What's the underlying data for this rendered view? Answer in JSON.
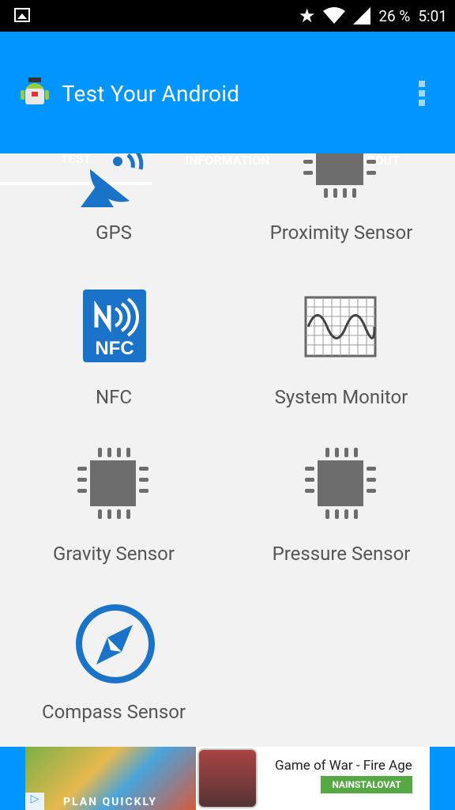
{
  "status": {
    "battery": "26 %",
    "time": "5:01"
  },
  "app": {
    "title": "Test Your Android"
  },
  "tabs": [
    "TEST",
    "INFORMATION",
    "ABOUT"
  ],
  "items": [
    {
      "label": "GPS",
      "icon": "satellite-dish-icon"
    },
    {
      "label": "Proximity Sensor",
      "icon": "chip-icon"
    },
    {
      "label": "NFC",
      "icon": "nfc-icon"
    },
    {
      "label": "System Monitor",
      "icon": "oscilloscope-icon"
    },
    {
      "label": "Gravity Sensor",
      "icon": "chip-icon"
    },
    {
      "label": "Pressure Sensor",
      "icon": "chip-icon"
    },
    {
      "label": "Compass Sensor",
      "icon": "compass-icon"
    }
  ],
  "ad": {
    "thumb_text": "PLAN QUICKLY",
    "name": "Game of War - Fire Age",
    "install": "NAINSTALOVAT"
  },
  "colors": {
    "primary": "#0095ff",
    "icon_gray": "#6d6d6d",
    "icon_blue": "#1a73c8"
  }
}
